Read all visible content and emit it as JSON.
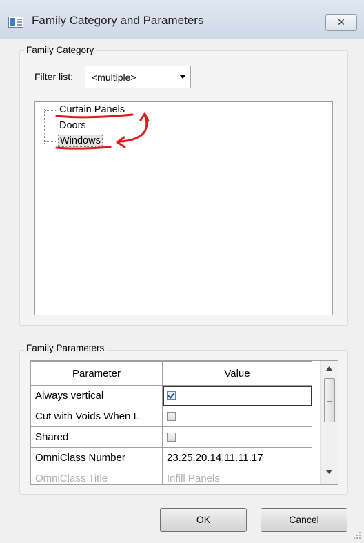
{
  "window": {
    "title": "Family Category and Parameters",
    "close_label": "✕"
  },
  "category": {
    "legend": "Family Category",
    "filter_label": "Filter list:",
    "filter_value": "<multiple>",
    "tree_items": [
      "Curtain Panels",
      "Doors",
      "Windows"
    ],
    "selected_item": "Windows"
  },
  "parameters": {
    "legend": "Family Parameters",
    "columns": [
      "Parameter",
      "Value"
    ],
    "rows": [
      {
        "name": "Always vertical",
        "value": "",
        "checkbox": true,
        "checked": true
      },
      {
        "name": "Cut with Voids When L",
        "value": "",
        "checkbox": true,
        "checked": false
      },
      {
        "name": "Shared",
        "value": "",
        "checkbox": true,
        "checked": false
      },
      {
        "name": "OmniClass Number",
        "value": "23.25.20.14.11.11.17",
        "checkbox": false
      },
      {
        "name": "OmniClass Title",
        "value": "Infill Panels",
        "checkbox": false
      }
    ]
  },
  "buttons": {
    "ok": "OK",
    "cancel": "Cancel"
  },
  "colors": {
    "annotation": "#e0191b"
  }
}
